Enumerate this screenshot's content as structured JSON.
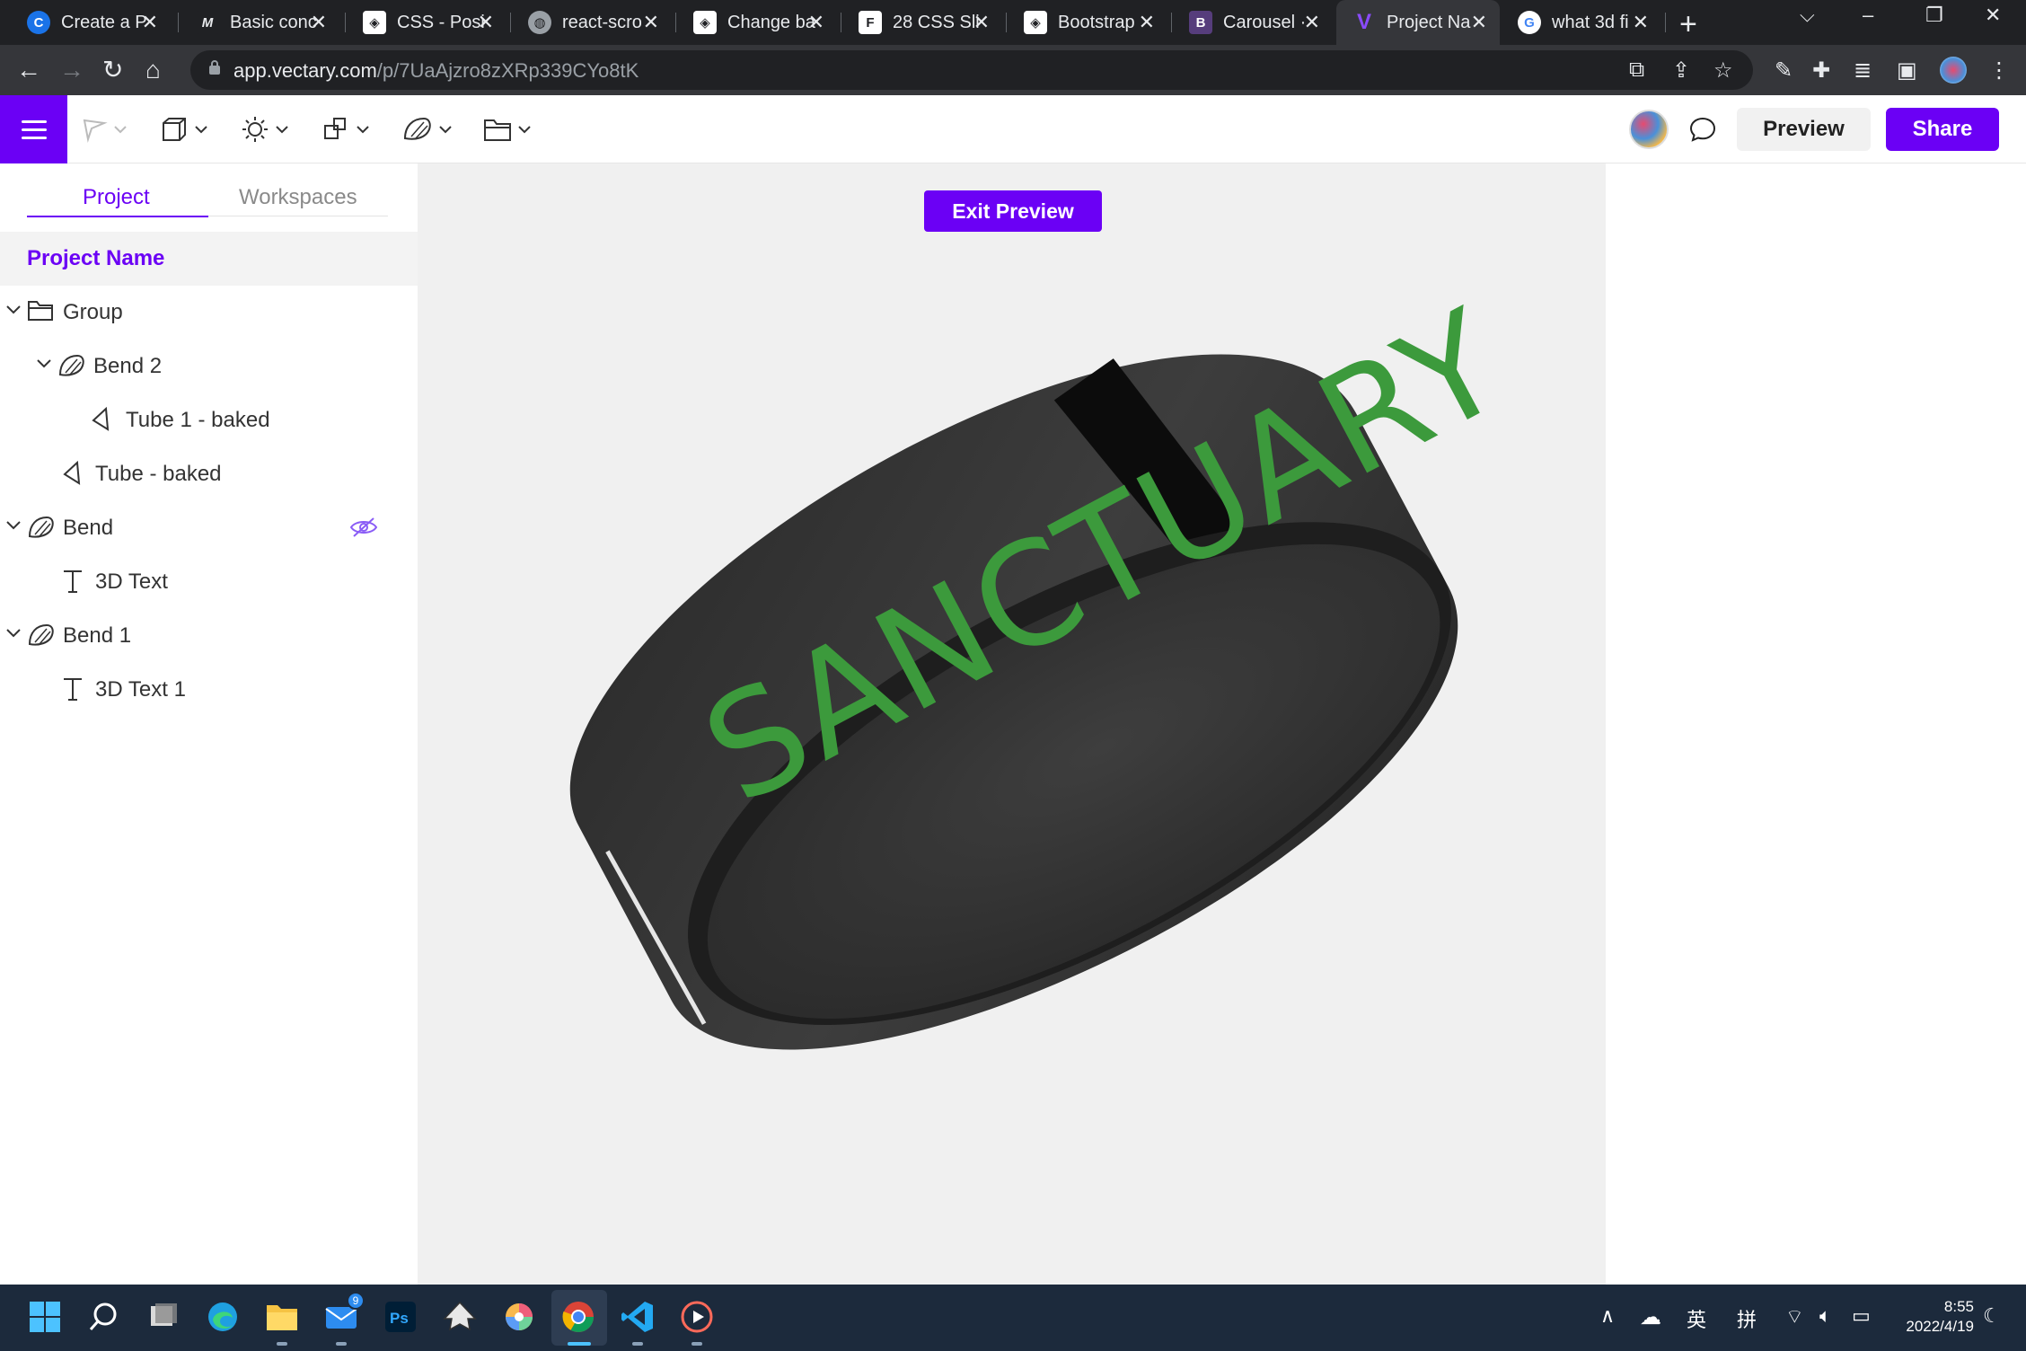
{
  "browser": {
    "tabs": [
      {
        "title": "Create a P",
        "favicon": "C",
        "icon": "create-icon"
      },
      {
        "title": "Basic conc",
        "favicon": "M",
        "icon": "medium-icon"
      },
      {
        "title": "CSS - Posi",
        "favicon": "◈",
        "icon": "codepen-icon"
      },
      {
        "title": "react-scro",
        "favicon": "◍",
        "icon": "globe-icon"
      },
      {
        "title": "Change ba",
        "favicon": "◈",
        "icon": "codepen-icon"
      },
      {
        "title": "28 CSS Sli",
        "favicon": "F",
        "icon": "f-icon"
      },
      {
        "title": "Bootstrap",
        "favicon": "◈",
        "icon": "codepen-icon"
      },
      {
        "title": "Carousel ·",
        "favicon": "B",
        "icon": "bootstrap-icon"
      },
      {
        "title": "Project Na",
        "favicon": "V",
        "icon": "vectary-icon",
        "active": true
      },
      {
        "title": "what 3d fi",
        "favicon": "G",
        "icon": "google-icon"
      }
    ],
    "new_tab": "+",
    "url_host": "app.vectary.com",
    "url_path": "/p/7UaAjzro8zXRp339CYo8tK"
  },
  "app": {
    "accent": "#6b00f5",
    "preview_label": "Preview",
    "share_label": "Share",
    "exit_preview_label": "Exit Preview",
    "toolbar_tools": [
      "select-tool-icon",
      "cube-icon",
      "light-icon",
      "shapes-icon",
      "deform-icon",
      "folder-icon"
    ]
  },
  "sidebar": {
    "tab_project": "Project",
    "tab_workspaces": "Workspaces",
    "project_name": "Project Name",
    "tree": [
      {
        "label": "Group",
        "icon": "folder-icon",
        "depth": 0,
        "expanded": true
      },
      {
        "label": "Bend 2",
        "icon": "bend-icon",
        "depth": 1,
        "expanded": true
      },
      {
        "label": "Tube 1 - baked",
        "icon": "mesh-icon",
        "depth": 2
      },
      {
        "label": "Tube - baked",
        "icon": "mesh-icon",
        "depth": 1
      },
      {
        "label": "Bend",
        "icon": "bend-icon",
        "depth": 0,
        "expanded": true,
        "hidden": true
      },
      {
        "label": "3D Text",
        "icon": "text-icon",
        "depth": 1
      },
      {
        "label": "Bend 1",
        "icon": "bend-icon",
        "depth": 0,
        "expanded": true
      },
      {
        "label": "3D Text 1",
        "icon": "text-icon",
        "depth": 1
      }
    ]
  },
  "scene": {
    "ring_text": "SANCTUARY",
    "ring_color": "#3a3a3a",
    "text_color": "#3c9a3c"
  },
  "taskbar": {
    "time": "8:55",
    "date": "2022/4/19",
    "mail_badge": "9",
    "ime_lang": "英",
    "ime_mode": "拼"
  }
}
